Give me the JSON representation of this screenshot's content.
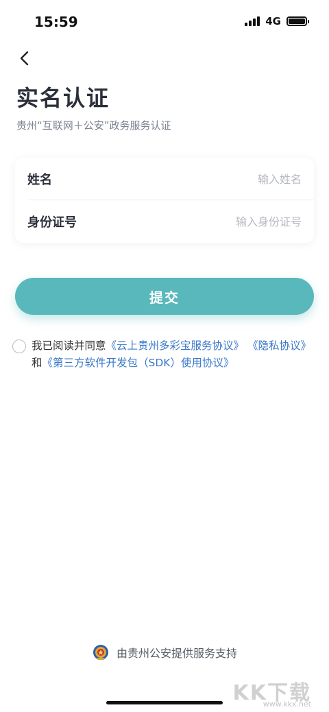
{
  "status_bar": {
    "time": "15:59",
    "network": "4G"
  },
  "header": {
    "back_icon": "chevron-left-icon",
    "title": "实名认证",
    "subtitle": "贵州“互联网＋公安”政务服务认证"
  },
  "form": {
    "name_label": "姓名",
    "name_placeholder": "输入姓名",
    "name_value": "",
    "id_label": "身份证号",
    "id_placeholder": "输入身份证号",
    "id_value": ""
  },
  "submit_label": "提交",
  "agreement": {
    "prefix": "我已阅读并同意",
    "link1": "《云上贵州多彩宝服务协议》",
    "link2": "《隐私协议》",
    "conj": "和",
    "link3": "《第三方软件开发包（SDK）使用协议》"
  },
  "footer": {
    "emblem_icon": "police-emblem-icon",
    "text": "由贵州公安提供服务支持"
  },
  "watermark": {
    "logo": "KK下载",
    "url": "www.kkx.net"
  },
  "colors": {
    "accent": "#58b8bc",
    "link": "#3a78c9"
  }
}
